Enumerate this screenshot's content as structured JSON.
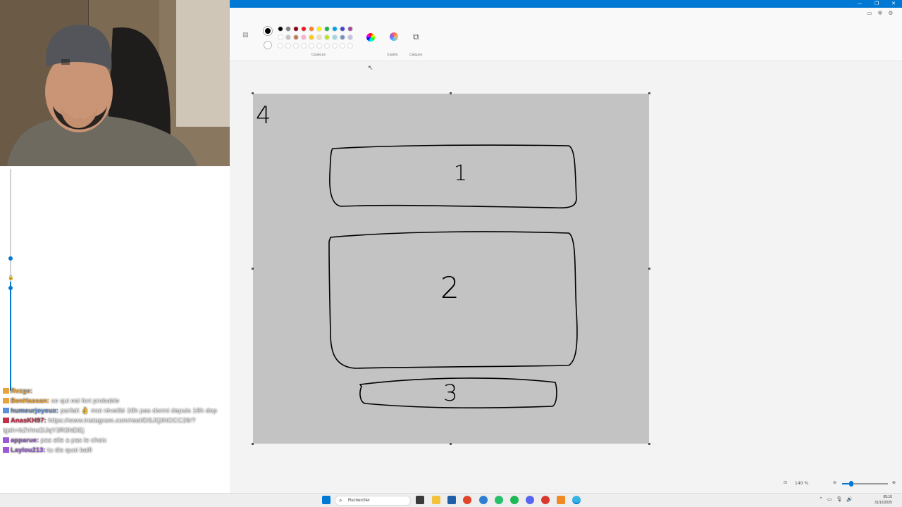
{
  "paint": {
    "ribbon": {
      "colors_label": "Couleurs",
      "copilot_label": "Copilot",
      "layers_label": "Calques",
      "primary_color": "#000000",
      "secondary_color": "#ffffff",
      "palette_row1": [
        "#000000",
        "#7f7f7f",
        "#880015",
        "#ed1c24",
        "#ff7f27",
        "#fff200",
        "#22b14c",
        "#00a2e8",
        "#3f48cc",
        "#a349a4"
      ],
      "palette_row2": [
        "#ffffff",
        "#c3c3c3",
        "#b97a57",
        "#ffaec9",
        "#ffc90e",
        "#efe4b0",
        "#b5e61d",
        "#99d9ea",
        "#7092be",
        "#c8bfe7"
      ],
      "palette_row3": [
        "#ffffff",
        "#ffffff",
        "#ffffff",
        "#ffffff",
        "#ffffff",
        "#ffffff",
        "#ffffff",
        "#ffffff",
        "#ffffff",
        "#ffffff"
      ]
    },
    "canvas": {
      "background": "#c3c3c3",
      "labels": {
        "corner": "4",
        "box1": "1",
        "box2": "2",
        "box3": "3"
      }
    },
    "status": {
      "zoom": "140 %"
    }
  },
  "chat": {
    "messages": [
      {
        "user": "Rvzge:",
        "text": "",
        "color": "#e8a23a"
      },
      {
        "user": "BenHassan:",
        "text": "ce qui est fort probable",
        "color": "#e8a23a"
      },
      {
        "user": "humeurjoyeux:",
        "text": "parfait 👌 moi réveillé 16h pas dormi depuis 16h dep",
        "color": "#5b8fd9"
      },
      {
        "user": "AnasKH97:",
        "text": "https://www.instagram.com/reel/DSJQtNOCC29/?igsh=b2VmcDJqY3R3NDEj",
        "color": "#c0304a"
      },
      {
        "user": "apparue:",
        "text": "pas elle a pas le choix",
        "color": "#9b59d6"
      },
      {
        "user": "Laylou213:",
        "text": "tu dis quoi balfi",
        "color": "#9b59d6"
      }
    ]
  },
  "taskbar": {
    "search_placeholder": "Rechercher",
    "time": "05:10",
    "date": "31/12/2025"
  }
}
